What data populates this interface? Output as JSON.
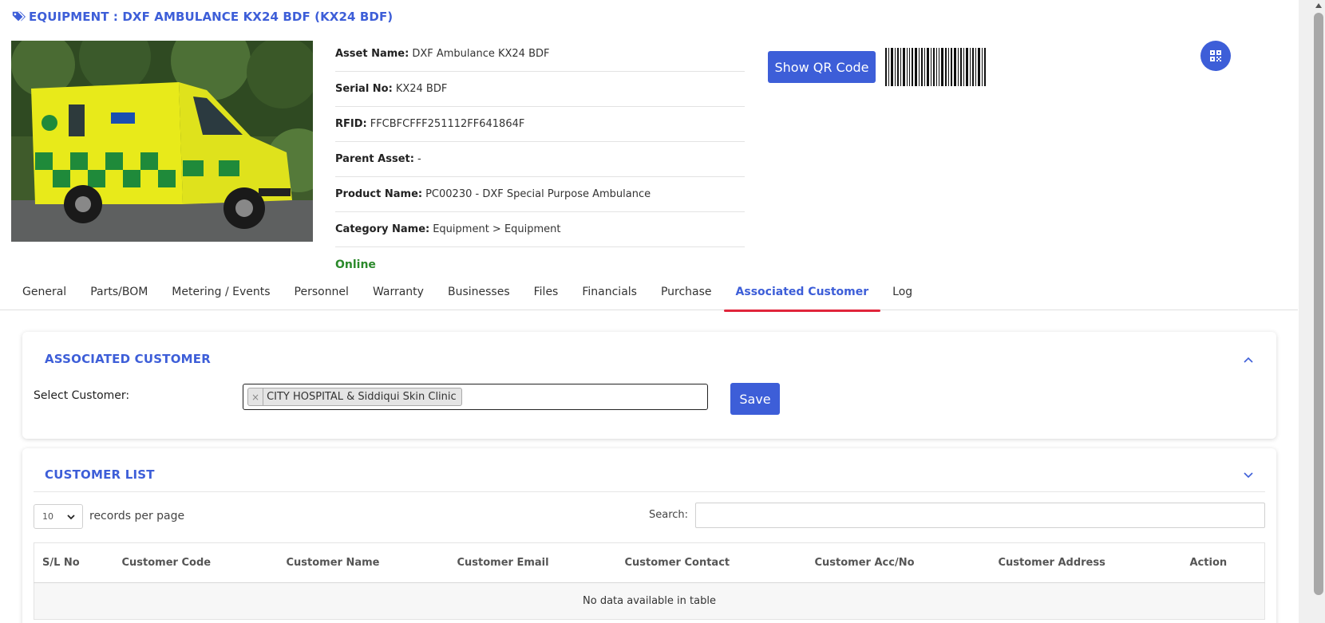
{
  "header": {
    "title": "EQUIPMENT : DXF AMBULANCE KX24 BDF (KX24 BDF)"
  },
  "details": [
    {
      "label": "Asset Name:",
      "value": "DXF Ambulance KX24 BDF"
    },
    {
      "label": "Serial No:",
      "value": "KX24 BDF"
    },
    {
      "label": "RFID:",
      "value": "FFCBFCFFF251112FF641864F"
    },
    {
      "label": "Parent Asset:",
      "value": "-"
    },
    {
      "label": "Product Name:",
      "value": "PC00230 - DXF Special Purpose Ambulance"
    },
    {
      "label": "Category Name:",
      "value": "Equipment > Equipment"
    }
  ],
  "status": "Online",
  "qr_button": "Show QR Code",
  "tabs": [
    {
      "label": "General"
    },
    {
      "label": "Parts/BOM"
    },
    {
      "label": "Metering / Events"
    },
    {
      "label": "Personnel"
    },
    {
      "label": "Warranty"
    },
    {
      "label": "Businesses"
    },
    {
      "label": "Files"
    },
    {
      "label": "Financials"
    },
    {
      "label": "Purchase"
    },
    {
      "label": "Associated Customer",
      "active": true
    },
    {
      "label": "Log"
    }
  ],
  "associated_customer": {
    "title": "ASSOCIATED CUSTOMER",
    "select_label": "Select Customer:",
    "selected": "CITY HOSPITAL & Siddiqui Skin Clinic",
    "remove_glyph": "×",
    "save_label": "Save"
  },
  "customer_list": {
    "title": "CUSTOMER LIST",
    "page_length": "10",
    "records_label": "records per page",
    "search_label": "Search:",
    "columns": [
      "S/L No",
      "Customer Code",
      "Customer Name",
      "Customer Email",
      "Customer Contact",
      "Customer Acc/No",
      "Customer Address",
      "Action"
    ],
    "empty_text": "No data available in table"
  },
  "colors": {
    "accent": "#3d5ed8",
    "active_underline": "#e0253b",
    "online": "#2b8a2b"
  },
  "icons": {
    "title": "tag-icon",
    "round_button": "qr-grid-icon",
    "collapse": "chevron-up-icon",
    "expand": "chevron-down-icon"
  }
}
